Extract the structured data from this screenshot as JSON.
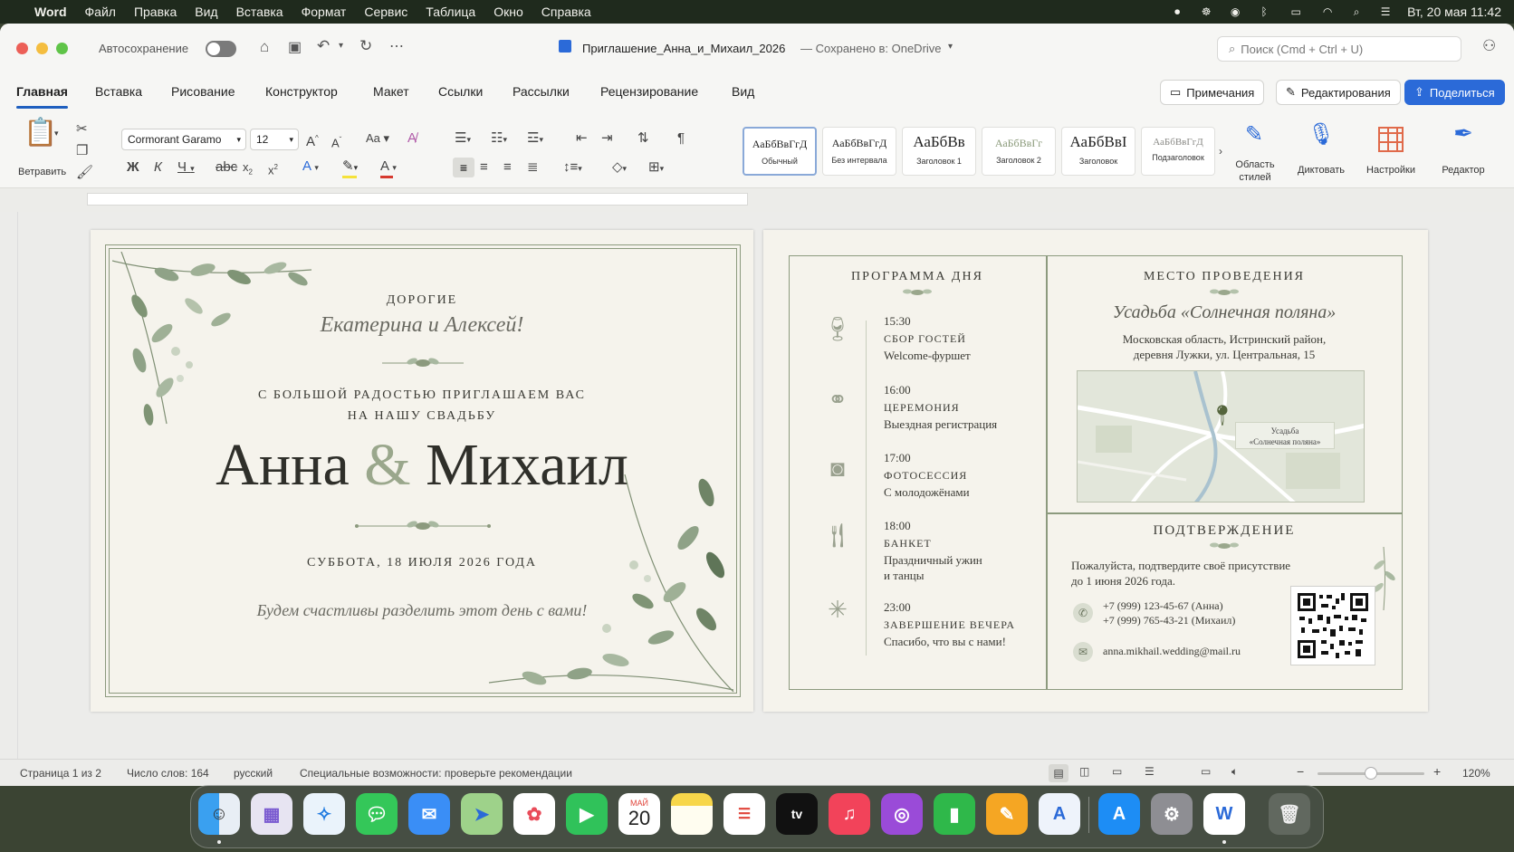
{
  "menubar": {
    "app_name": "Word",
    "items": [
      "Файл",
      "Правка",
      "Вид",
      "Вставка",
      "Формат",
      "Сервис",
      "Таблица",
      "Окно",
      "Справка"
    ],
    "clock": "Вт, 20 мая  11:42"
  },
  "titlebar": {
    "autosave_label": "Автосохранение",
    "doc_title": "Приглашение_Анна_и_Михаил_2026",
    "saved_status": "— Сохранено в: OneDrive",
    "search_placeholder": "Поиск (Cmd + Ctrl + U)"
  },
  "tabs": [
    "Главная",
    "Вставка",
    "Рисование",
    "Конструктор",
    "Макет",
    "Ссылки",
    "Рассылки",
    "Рецензирование",
    "Вид"
  ],
  "tab_buttons": {
    "comments": "Примечания",
    "editing": "Редактирования",
    "share": "Поделиться"
  },
  "ribbon": {
    "paste_label": "Ветравить",
    "font_name": "Cormorant Garamo",
    "font_size": "12",
    "styles": [
      {
        "sample": "АаБбВвГгД",
        "name": "Обычный"
      },
      {
        "sample": "АаБбВвГгД",
        "name": "Без интервала"
      },
      {
        "sample": "АаБбВв",
        "name": "Заголовок 1"
      },
      {
        "sample": "АаБбВвГг",
        "name": "Заголовок 2"
      },
      {
        "sample": "АаБбВвI",
        "name": "Заголовок"
      },
      {
        "sample": "АаБбВвГгД",
        "name": "Подзаголовок"
      }
    ],
    "styles_pane": [
      "Область",
      "стилей"
    ],
    "dictate": "Диктовать",
    "settings": "Настройки",
    "editor": "Редактор"
  },
  "invitation": {
    "dear": "ДОРОГИЕ",
    "guests": "Екатерина и Алексей!",
    "invite_line1": "С БОЛЬШОЙ РАДОСТЬЮ ПРИГЛАШАЕМ ВАС",
    "invite_line2": "НА НАШУ СВАДЬБУ",
    "bride": "Анна",
    "amp": "&",
    "groom": "Михаил",
    "date": "СУББОТА, 18 ИЮЛЯ 2026 ГОДА",
    "closing": "Будем счастливы разделить этот день с вами!"
  },
  "program": {
    "title": "ПРОГРАММА ДНЯ",
    "items": [
      {
        "time": "15:30",
        "name": "СБОР ГОСТЕЙ",
        "desc": "Welcome-фуршет",
        "desc2": "",
        "icon": "glass-icon"
      },
      {
        "time": "16:00",
        "name": "ЦЕРЕМОНИЯ",
        "desc": "Выездная регистрация",
        "desc2": "",
        "icon": "rings-icon"
      },
      {
        "time": "17:00",
        "name": "ФОТОСЕССИЯ",
        "desc": "С молодожёнами",
        "desc2": "",
        "icon": "camera-icon"
      },
      {
        "time": "18:00",
        "name": "БАНКЕТ",
        "desc": "Праздничный ужин",
        "desc2": "и танцы",
        "icon": "fork-knife-icon"
      },
      {
        "time": "23:00",
        "name": "ЗАВЕРШЕНИЕ ВЕЧЕРА",
        "desc": "Спасибо, что вы с нами!",
        "desc2": "",
        "icon": "sparkle-icon"
      }
    ]
  },
  "venue": {
    "title": "МЕСТО ПРОВЕДЕНИЯ",
    "name": "Усадьба «Солнечная поляна»",
    "address1": "Московская область, Истринский район,",
    "address2": "деревня Лужки, ул. Центральная, 15",
    "map_label1": "Усадьба",
    "map_label2": "«Солнечная поляна»"
  },
  "rsvp": {
    "title": "ПОДТВЕРЖДЕНИЕ",
    "text1": "Пожалуйста, подтвердите своё присутствие",
    "text2": "до 1 июня 2026 года.",
    "phone1": "+7 (999) 123-45-67 (Анна)",
    "phone2": "+7 (999) 765-43-21 (Михаил)",
    "email": "anna.mikhail.wedding@mail.ru"
  },
  "status": {
    "page": "Страница 1 из 2",
    "words": "Число слов: 164",
    "lang": "русский",
    "accessibility": "Специальные возможности: проверьте рекомендации",
    "zoom": "120%"
  },
  "dock": {
    "calendar_month": "МАЙ",
    "calendar_day": "20"
  },
  "colors": {
    "accent_blue": "#2b6ad8",
    "sage": "#8c9a7e",
    "paper": "#f5f3ec"
  }
}
